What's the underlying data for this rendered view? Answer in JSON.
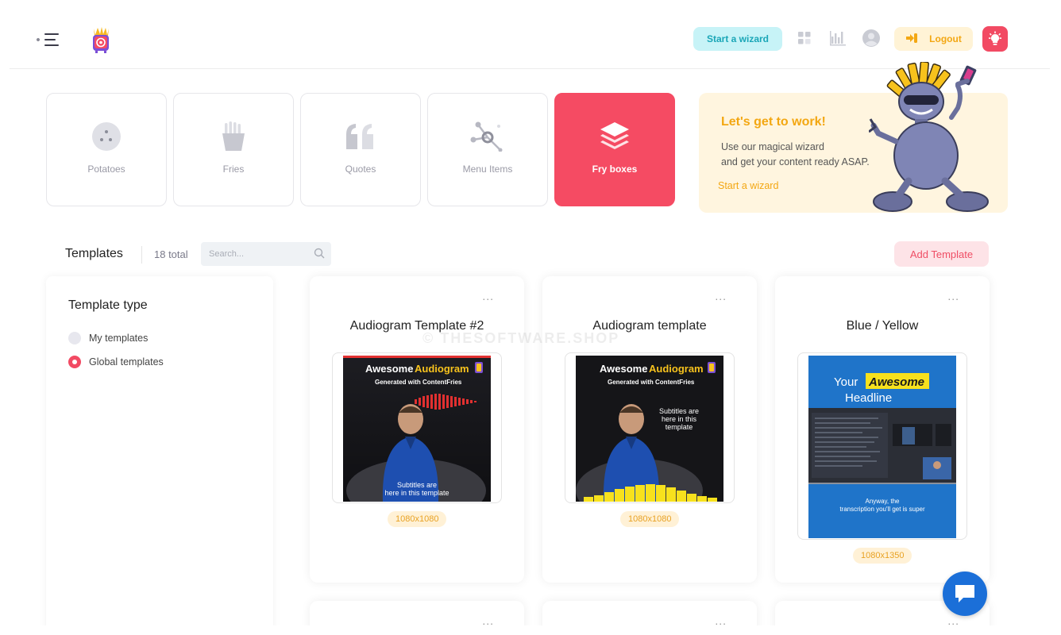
{
  "header": {
    "wizard_label": "Start a wizard",
    "logout_label": "Logout"
  },
  "categories": [
    {
      "label": "Potatoes",
      "icon": "potato-icon",
      "active": false
    },
    {
      "label": "Fries",
      "icon": "fries-icon",
      "active": false
    },
    {
      "label": "Quotes",
      "icon": "quote-icon",
      "active": false
    },
    {
      "label": "Menu Items",
      "icon": "nodes-icon",
      "active": false
    },
    {
      "label": "Fry boxes",
      "icon": "layers-icon",
      "active": true
    }
  ],
  "promo": {
    "title": "Let's get to work!",
    "line1": "Use our magical wizard",
    "line2": "and get your content ready ASAP.",
    "link": "Start a wizard"
  },
  "templates": {
    "title": "Templates",
    "count": "18 total",
    "search_placeholder": "Search...",
    "add_label": "Add Template"
  },
  "filter": {
    "title": "Template type",
    "options": [
      {
        "label": "My templates",
        "selected": false
      },
      {
        "label": "Global templates",
        "selected": true
      }
    ]
  },
  "cards": [
    {
      "title": "Audiogram Template #2",
      "size": "1080x1080",
      "thumb": {
        "headline_a": "Awesome",
        "headline_b": "Audiogram",
        "sub": "Generated with ContentFries",
        "caption1": "Subtitles are",
        "caption2": "here in this template"
      }
    },
    {
      "title": "Audiogram template",
      "size": "1080x1080",
      "thumb": {
        "headline_a": "Awesome",
        "headline_b": "Audiogram",
        "sub": "Generated with ContentFries",
        "caption1": "Subtitles are",
        "caption2": "here in this",
        "caption3": "template"
      }
    },
    {
      "title": "Blue / Yellow",
      "size": "1080x1350",
      "thumb": {
        "headline_a": "Your",
        "headline_b": "Awesome",
        "headline_c": "Headline",
        "caption1": "Anyway, the",
        "caption2": "transcription you'll get is super"
      }
    }
  ],
  "watermark": "© THESOFTWARE.SHOP",
  "colors": {
    "accent": "#f54b63",
    "wizard": "#c7f3f7",
    "logout": "#fff3d6",
    "promo": "#fff5df",
    "chat": "#1b6fd8"
  }
}
